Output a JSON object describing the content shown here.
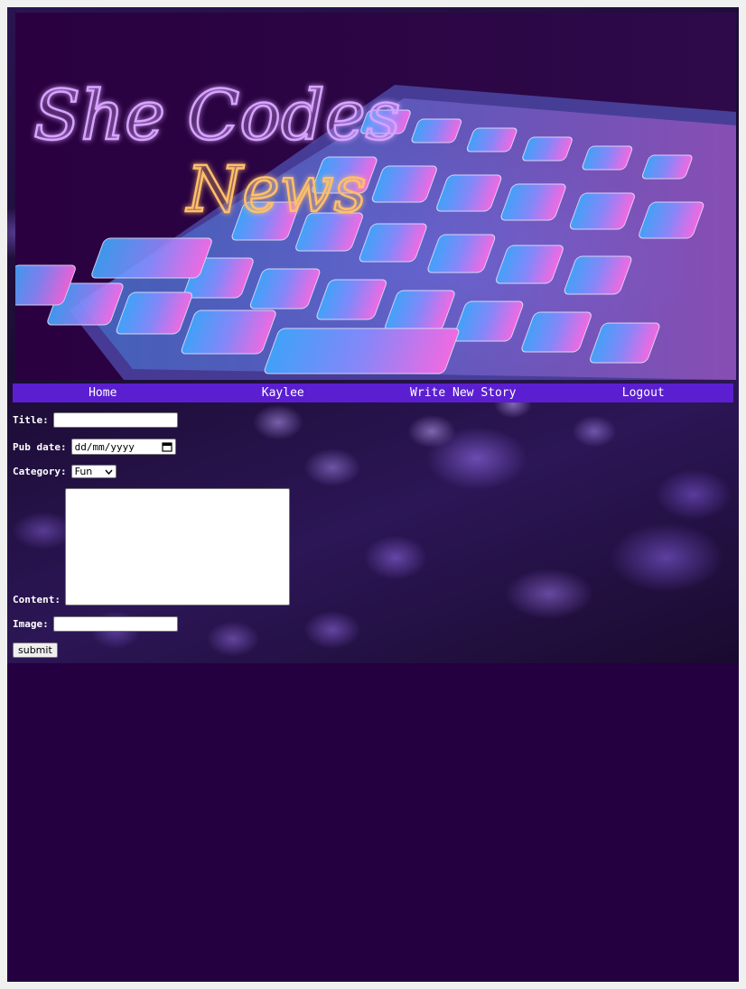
{
  "hero": {
    "title_line1": "She Codes",
    "title_line2": "News"
  },
  "nav": {
    "items": [
      {
        "label": "Home"
      },
      {
        "label": "Kaylee"
      },
      {
        "label": "Write New Story"
      },
      {
        "label": "Logout"
      }
    ]
  },
  "form": {
    "title_label": "Title:",
    "title_value": "",
    "pub_date_label": "Pub date:",
    "pub_date_placeholder": "dd/mm/yyyy",
    "category_label": "Category:",
    "category_selected": "Fun",
    "content_label": "Content:",
    "content_value": "",
    "image_label": "Image:",
    "image_value": "",
    "submit_label": "submit"
  },
  "colors": {
    "page_bg": "#240041",
    "nav_bg": "#5b1fd1",
    "nav_text": "#ffffff"
  },
  "icons": {
    "calendar": "calendar-icon",
    "dropdown": "chevron-down-icon"
  }
}
